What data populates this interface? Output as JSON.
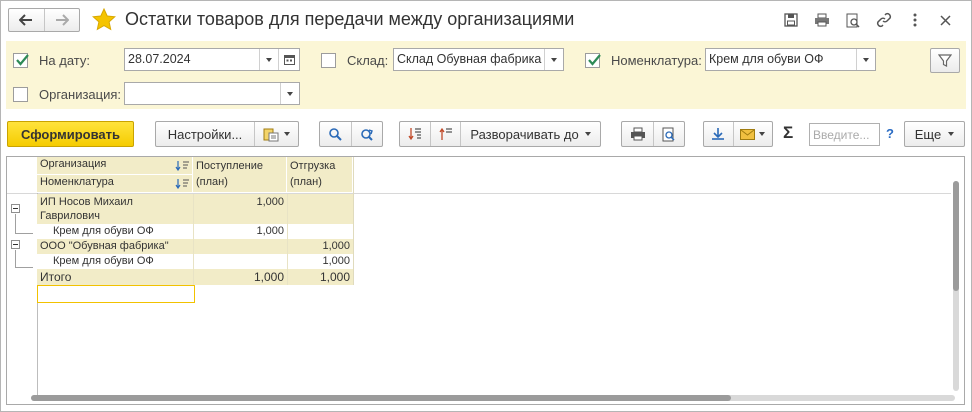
{
  "window": {
    "title": "Остатки товаров для передачи между организациями"
  },
  "filters": {
    "date": {
      "checked": true,
      "label": "На дату:",
      "value": "28.07.2024"
    },
    "warehouse": {
      "checked": false,
      "label": "Склад:",
      "value": "Склад Обувная фабрика"
    },
    "nomenclature": {
      "checked": true,
      "label": "Номенклатура:",
      "value": "Крем для обуви ОФ"
    },
    "organization": {
      "checked": false,
      "label": "Организация:",
      "value": ""
    }
  },
  "toolbar": {
    "generate_label": "Сформировать",
    "settings_label": "Настройки...",
    "expand_label": "Разворачивать до",
    "search_placeholder": "Введите...",
    "help_label": "?",
    "more_label": "Еще",
    "sigma_label": "Σ"
  },
  "report": {
    "headers": {
      "organization": "Организация",
      "nomenclature": "Номенклатура",
      "receipt": "Поступление (план)",
      "receipt_l1": "Поступление",
      "receipt_l2": "(план)",
      "shipment": "Отгрузка (план)",
      "shipment_l1": "Отгрузка",
      "shipment_l2": "(план)"
    },
    "rows": [
      {
        "level": 1,
        "name_l1": "ИП Носов Михаил",
        "name_l2": "Гаврилович",
        "receipt": "1,000",
        "shipment": ""
      },
      {
        "level": 2,
        "name": "Крем для обуви ОФ",
        "receipt": "1,000",
        "shipment": ""
      },
      {
        "level": 1,
        "name": "ООО \"Обувная фабрика\"",
        "receipt": "",
        "shipment": "1,000"
      },
      {
        "level": 2,
        "name": "Крем для обуви ОФ",
        "receipt": "",
        "shipment": "1,000"
      }
    ],
    "total": {
      "label": "Итого",
      "receipt": "1,000",
      "shipment": "1,000"
    }
  },
  "colors": {
    "filter_bg": "#fbf6d6",
    "header_bg": "#f2ecc8",
    "primary_button": "#f5cc00",
    "selection_border": "#f2c200"
  }
}
